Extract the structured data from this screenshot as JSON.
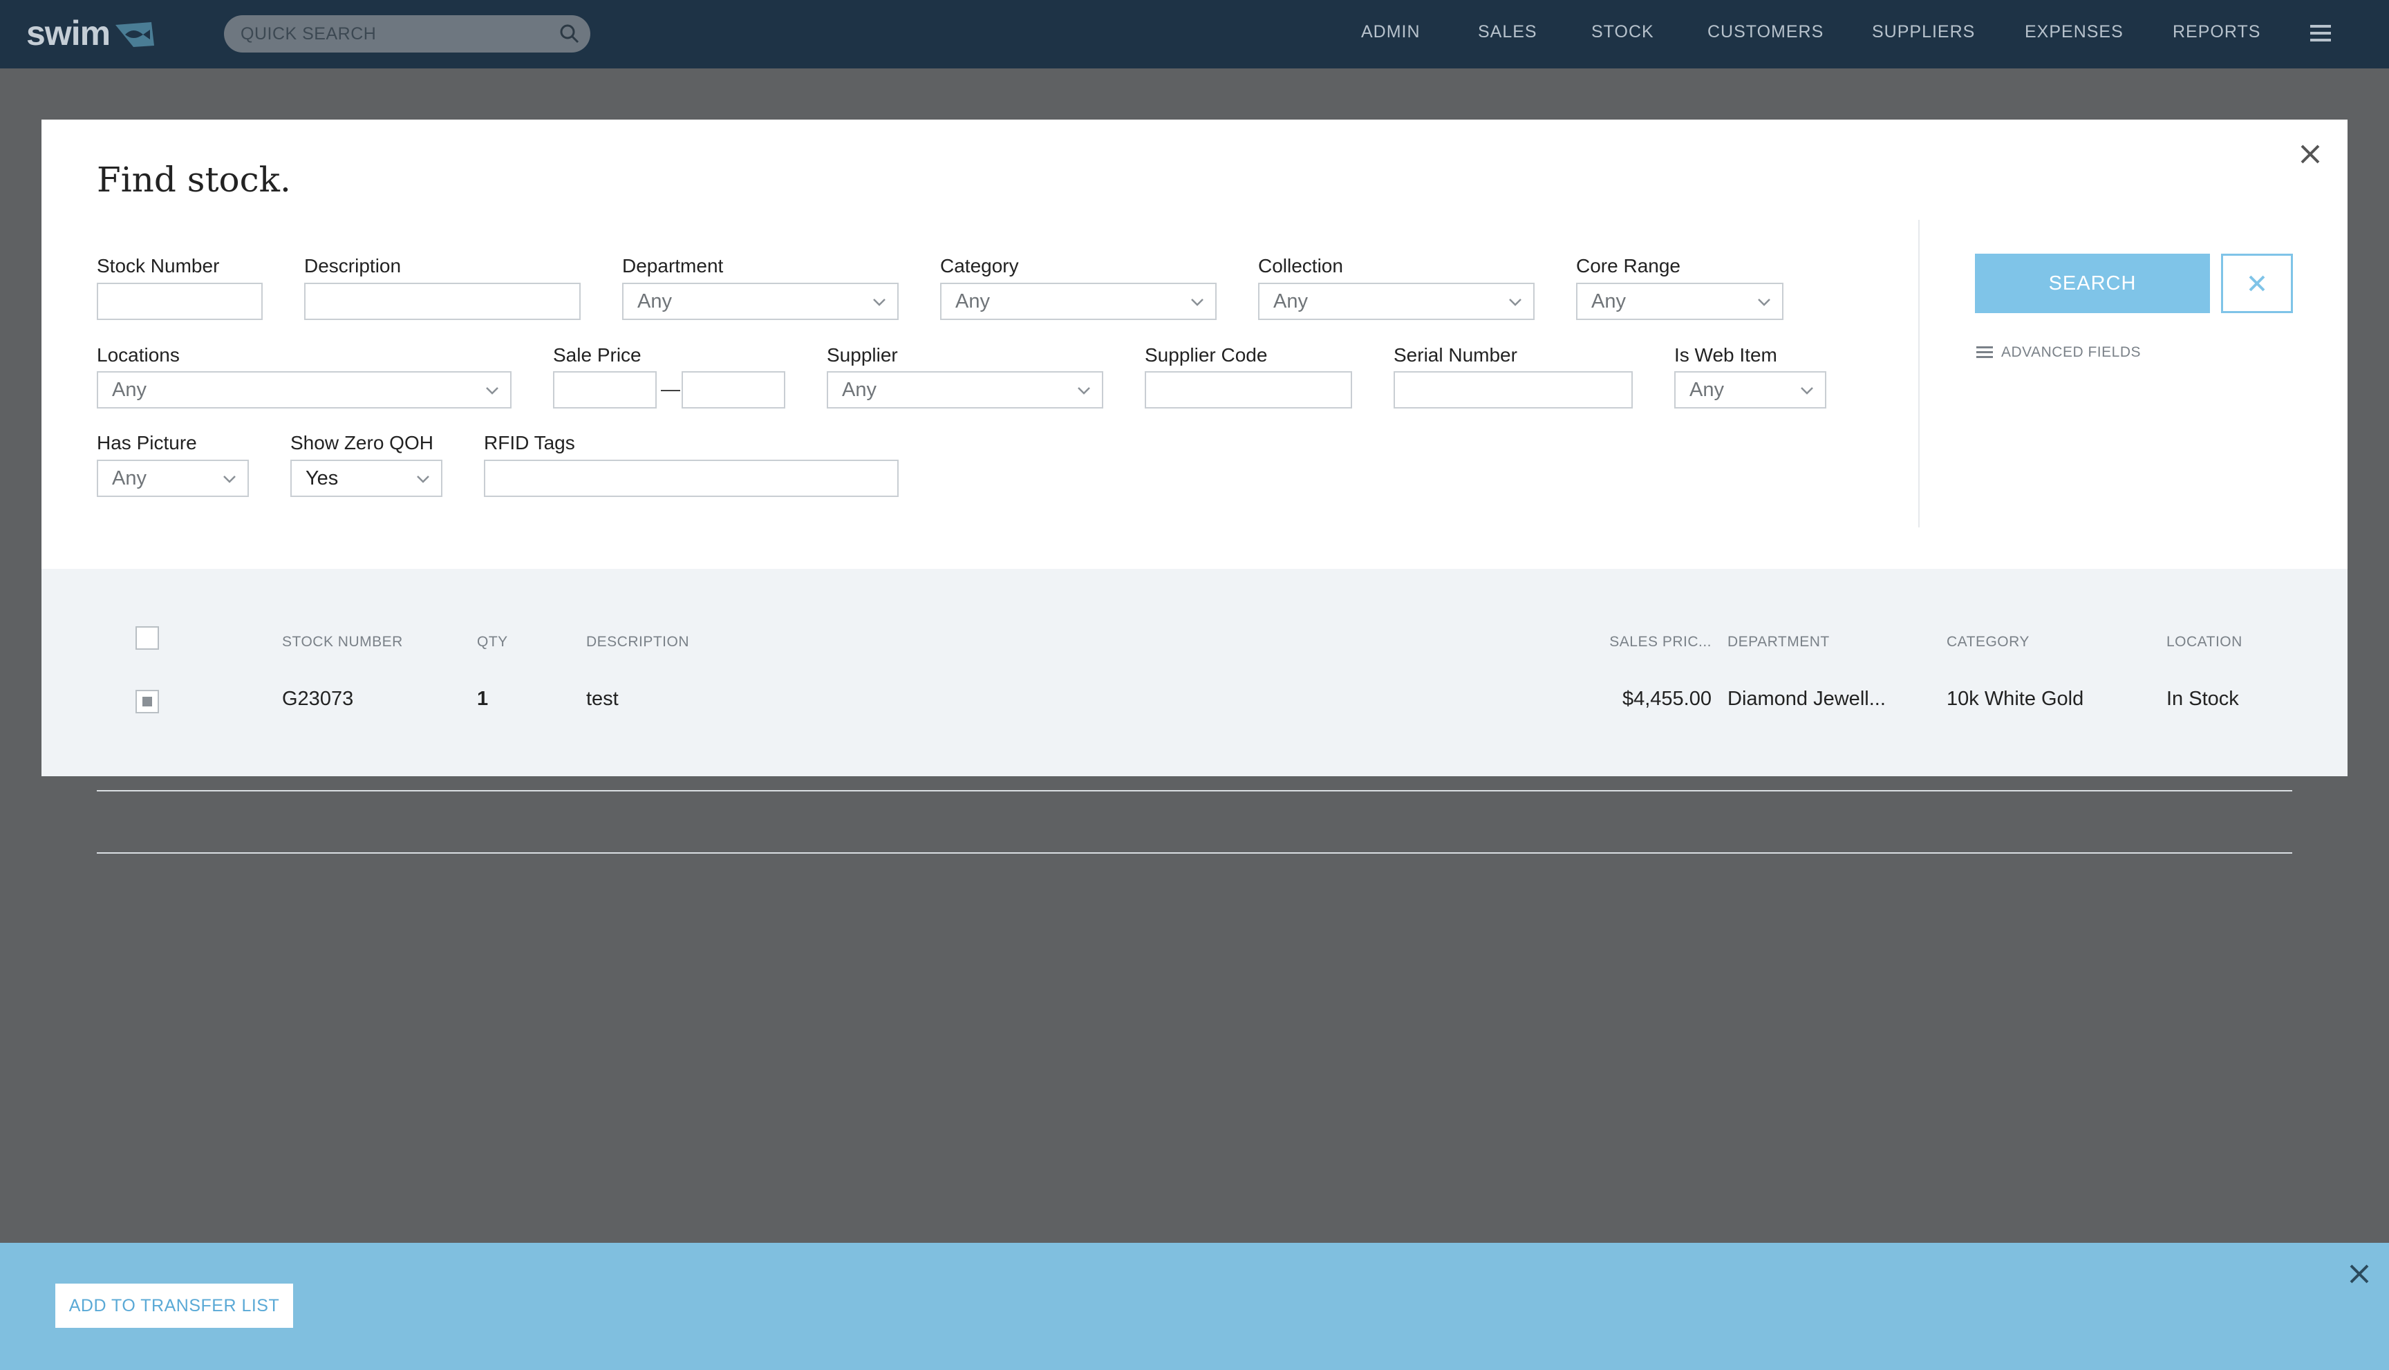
{
  "app": {
    "logo_text": "swim",
    "quick_search_placeholder": "QUICK SEARCH",
    "nav": [
      "ADMIN",
      "SALES",
      "STOCK",
      "CUSTOMERS",
      "SUPPLIERS",
      "EXPENSES",
      "REPORTS"
    ]
  },
  "colors": {
    "nav_bg": "#1e3346",
    "accent": "#7fc4e8",
    "overlay": "#5f6163",
    "bottom_bar": "#80bfdf"
  },
  "modal": {
    "title": "Find stock.",
    "fields": {
      "stock_number": {
        "label": "Stock Number",
        "value": ""
      },
      "description": {
        "label": "Description",
        "value": ""
      },
      "department": {
        "label": "Department",
        "value": "Any"
      },
      "category": {
        "label": "Category",
        "value": "Any"
      },
      "collection": {
        "label": "Collection",
        "value": "Any"
      },
      "core_range": {
        "label": "Core Range",
        "value": "Any"
      },
      "locations": {
        "label": "Locations",
        "value": "Any"
      },
      "sale_price": {
        "label": "Sale Price",
        "min": "",
        "max": "",
        "separator": "—"
      },
      "supplier": {
        "label": "Supplier",
        "value": "Any"
      },
      "supplier_code": {
        "label": "Supplier Code",
        "value": ""
      },
      "serial_number": {
        "label": "Serial Number",
        "value": ""
      },
      "is_web_item": {
        "label": "Is Web Item",
        "value": "Any"
      },
      "has_picture": {
        "label": "Has Picture",
        "value": "Any"
      },
      "show_zero_qoh": {
        "label": "Show Zero QOH",
        "value": "Yes"
      },
      "rfid_tags": {
        "label": "RFID Tags",
        "value": ""
      }
    },
    "search_label": "SEARCH",
    "advanced_fields_label": "ADVANCED FIELDS"
  },
  "results": {
    "columns": [
      "STOCK NUMBER",
      "QTY",
      "DESCRIPTION",
      "SALES PRIC...",
      "DEPARTMENT",
      "CATEGORY",
      "LOCATION"
    ],
    "rows": [
      {
        "selected": true,
        "stock_number": "G23073",
        "qty": "1",
        "description": "test",
        "sales_price": "$4,455.00",
        "department": "Diamond Jewell...",
        "category": "10k White Gold",
        "location": "In Stock"
      }
    ]
  },
  "bottom_bar": {
    "action_label": "ADD TO TRANSFER LIST"
  },
  "icons": [
    "search-icon",
    "menu-icon",
    "close-icon",
    "chevron-down-icon",
    "list-icon",
    "fish-logo-icon"
  ]
}
